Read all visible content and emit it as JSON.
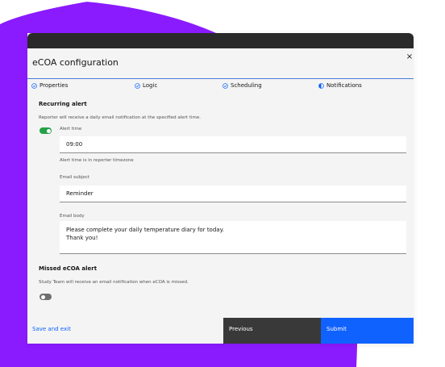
{
  "dialog": {
    "title": "eCOA configuration",
    "close_glyph": "×"
  },
  "steps": [
    {
      "label": "Properties",
      "state": "complete",
      "icon": "check-circle-icon"
    },
    {
      "label": "Logic",
      "state": "complete",
      "icon": "check-circle-icon"
    },
    {
      "label": "Scheduling",
      "state": "complete",
      "icon": "check-circle-icon"
    },
    {
      "label": "Notifications",
      "state": "current",
      "icon": "half-circle-icon"
    }
  ],
  "recurring": {
    "title": "Recurring alert",
    "help": "Reporter will receive a daily email notification at the specified alert time.",
    "toggle_on": true,
    "alert_time_label": "Alert time",
    "alert_time_value": "09:00",
    "alert_time_help": "Alert time is in reporter timezone",
    "email_subject_label": "Email subject",
    "email_subject_value": "Reminder",
    "email_body_label": "Email body",
    "email_body_line1": "Please complete your daily temperature diary for today.",
    "email_body_line2": "Thank you!"
  },
  "missed": {
    "title": "Missed eCOA alert",
    "help": "Study Team will receive an email notification when eCOA is missed.",
    "toggle_on": false
  },
  "footer": {
    "save_label": "Save and exit",
    "previous_label": "Previous",
    "submit_label": "Submit"
  },
  "colors": {
    "accent": "#0f62fe",
    "toggle_on": "#24a148",
    "toggle_off": "#6f6f6f",
    "background_blob": "#8a1bff"
  }
}
